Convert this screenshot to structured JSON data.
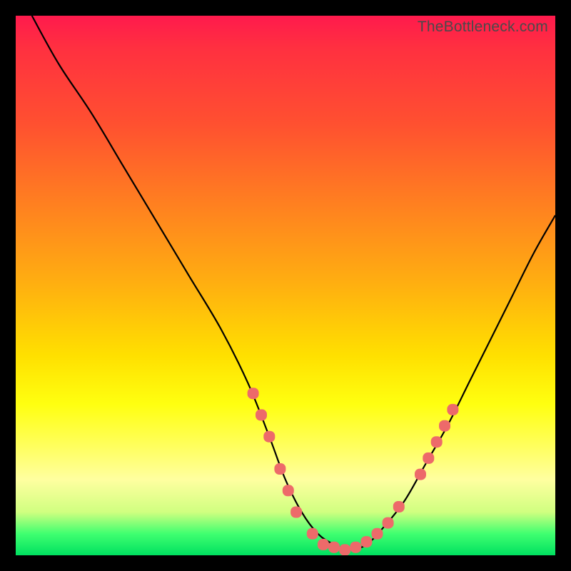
{
  "watermark": "TheBottleneck.com",
  "colors": {
    "background": "#000000",
    "curve": "#000000",
    "marker_fill": "#ed6a6a",
    "gradient_top": "#ff1a4d",
    "gradient_bottom": "#00e060"
  },
  "chart_data": {
    "type": "line",
    "title": "",
    "xlabel": "",
    "ylabel": "",
    "xlim": [
      0,
      100
    ],
    "ylim": [
      0,
      100
    ],
    "grid": false,
    "legend": false,
    "series": [
      {
        "name": "bottleneck-curve",
        "x": [
          3,
          8,
          14,
          20,
          26,
          32,
          38,
          43,
          47,
          50,
          53,
          56,
          59,
          62,
          65,
          68,
          72,
          76,
          80,
          84,
          88,
          92,
          96,
          100
        ],
        "y": [
          100,
          91,
          82,
          72,
          62,
          52,
          42,
          32,
          22,
          14,
          8,
          4,
          2,
          1,
          2,
          5,
          10,
          17,
          24,
          32,
          40,
          48,
          56,
          63
        ]
      }
    ],
    "markers": {
      "name": "highlighted-points",
      "points": [
        {
          "x": 44,
          "y": 30
        },
        {
          "x": 45.5,
          "y": 26
        },
        {
          "x": 47,
          "y": 22
        },
        {
          "x": 49,
          "y": 16
        },
        {
          "x": 50.5,
          "y": 12
        },
        {
          "x": 52,
          "y": 8
        },
        {
          "x": 55,
          "y": 4
        },
        {
          "x": 57,
          "y": 2
        },
        {
          "x": 59,
          "y": 1.5
        },
        {
          "x": 61,
          "y": 1
        },
        {
          "x": 63,
          "y": 1.5
        },
        {
          "x": 65,
          "y": 2.5
        },
        {
          "x": 67,
          "y": 4
        },
        {
          "x": 69,
          "y": 6
        },
        {
          "x": 71,
          "y": 9
        },
        {
          "x": 75,
          "y": 15
        },
        {
          "x": 76.5,
          "y": 18
        },
        {
          "x": 78,
          "y": 21
        },
        {
          "x": 79.5,
          "y": 24
        },
        {
          "x": 81,
          "y": 27
        }
      ]
    }
  }
}
